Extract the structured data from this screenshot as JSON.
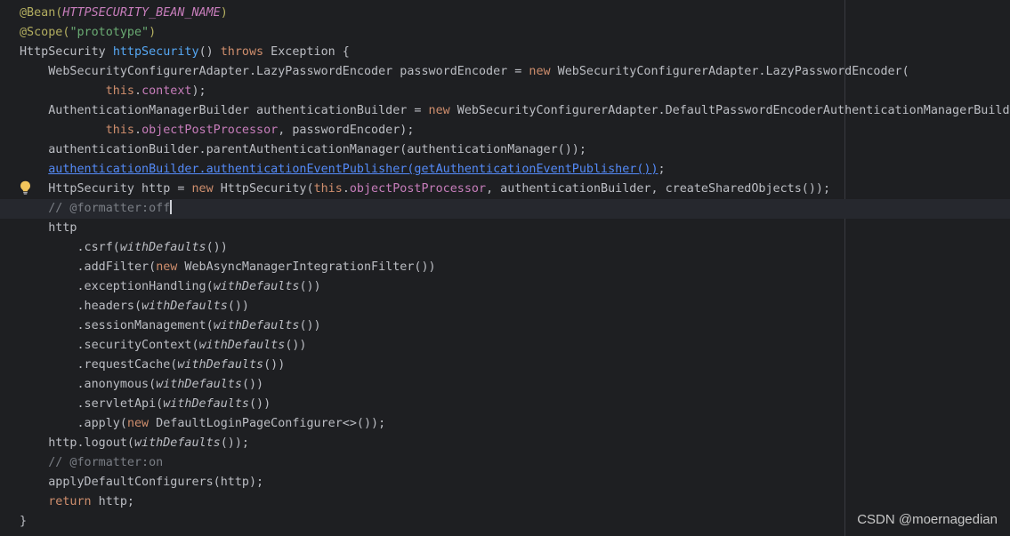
{
  "editor": {
    "caret_line": 10,
    "bulb_line": 9,
    "lines": [
      {
        "indent": "",
        "tokens": [
          {
            "c": "ann",
            "t": "@Bean("
          },
          {
            "c": "annarg",
            "t": "HTTPSECURITY_BEAN_NAME"
          },
          {
            "c": "ann",
            "t": ")"
          }
        ]
      },
      {
        "indent": "",
        "tokens": [
          {
            "c": "ann",
            "t": "@Scope("
          },
          {
            "c": "str",
            "t": "\"prototype\""
          },
          {
            "c": "ann",
            "t": ")"
          }
        ]
      },
      {
        "indent": "",
        "tokens": [
          {
            "c": "plain",
            "t": "HttpSecurity "
          },
          {
            "c": "method",
            "t": "httpSecurity"
          },
          {
            "c": "plain",
            "t": "() "
          },
          {
            "c": "kw",
            "t": "throws"
          },
          {
            "c": "plain",
            "t": " Exception {"
          }
        ]
      },
      {
        "indent": "    ",
        "tokens": [
          {
            "c": "plain",
            "t": "WebSecurityConfigurerAdapter.LazyPasswordEncoder passwordEncoder = "
          },
          {
            "c": "kw",
            "t": "new"
          },
          {
            "c": "plain",
            "t": " WebSecurityConfigurerAdapter.LazyPasswordEncoder("
          }
        ]
      },
      {
        "indent": "            ",
        "tokens": [
          {
            "c": "kw",
            "t": "this"
          },
          {
            "c": "plain",
            "t": "."
          },
          {
            "c": "field",
            "t": "context"
          },
          {
            "c": "plain",
            "t": ");"
          }
        ]
      },
      {
        "indent": "    ",
        "tokens": [
          {
            "c": "plain",
            "t": "AuthenticationManagerBuilder authenticationBuilder = "
          },
          {
            "c": "kw",
            "t": "new"
          },
          {
            "c": "plain",
            "t": " WebSecurityConfigurerAdapter.DefaultPasswordEncoderAuthenticationManagerBuilde"
          }
        ]
      },
      {
        "indent": "            ",
        "tokens": [
          {
            "c": "kw",
            "t": "this"
          },
          {
            "c": "plain",
            "t": "."
          },
          {
            "c": "field",
            "t": "objectPostProcessor"
          },
          {
            "c": "plain",
            "t": ", passwordEncoder);"
          }
        ]
      },
      {
        "indent": "    ",
        "tokens": [
          {
            "c": "plain",
            "t": "authenticationBuilder.parentAuthenticationManager(authenticationManager());"
          }
        ]
      },
      {
        "indent": "    ",
        "tokens": [
          {
            "c": "link",
            "t": "authenticationBuilder.authenticationEventPublisher(getAuthenticationEventPublisher())"
          },
          {
            "c": "plain",
            "t": ";"
          }
        ]
      },
      {
        "indent": "    ",
        "tokens": [
          {
            "c": "plain",
            "t": "HttpSecurity http = "
          },
          {
            "c": "kw",
            "t": "new"
          },
          {
            "c": "plain",
            "t": " HttpSecurity("
          },
          {
            "c": "kw",
            "t": "this"
          },
          {
            "c": "plain",
            "t": "."
          },
          {
            "c": "field",
            "t": "objectPostProcessor"
          },
          {
            "c": "plain",
            "t": ", authenticationBuilder, createSharedObjects());"
          }
        ]
      },
      {
        "indent": "    ",
        "tokens": [
          {
            "c": "comment",
            "t": "// @formatter:off"
          }
        ]
      },
      {
        "indent": "    ",
        "tokens": [
          {
            "c": "plain",
            "t": "http"
          }
        ]
      },
      {
        "indent": "        ",
        "tokens": [
          {
            "c": "plain",
            "t": ".csrf("
          },
          {
            "c": "italic",
            "t": "withDefaults"
          },
          {
            "c": "plain",
            "t": "())"
          }
        ]
      },
      {
        "indent": "        ",
        "tokens": [
          {
            "c": "plain",
            "t": ".addFilter("
          },
          {
            "c": "kw",
            "t": "new"
          },
          {
            "c": "plain",
            "t": " WebAsyncManagerIntegrationFilter())"
          }
        ]
      },
      {
        "indent": "        ",
        "tokens": [
          {
            "c": "plain",
            "t": ".exceptionHandling("
          },
          {
            "c": "italic",
            "t": "withDefaults"
          },
          {
            "c": "plain",
            "t": "())"
          }
        ]
      },
      {
        "indent": "        ",
        "tokens": [
          {
            "c": "plain",
            "t": ".headers("
          },
          {
            "c": "italic",
            "t": "withDefaults"
          },
          {
            "c": "plain",
            "t": "())"
          }
        ]
      },
      {
        "indent": "        ",
        "tokens": [
          {
            "c": "plain",
            "t": ".sessionManagement("
          },
          {
            "c": "italic",
            "t": "withDefaults"
          },
          {
            "c": "plain",
            "t": "())"
          }
        ]
      },
      {
        "indent": "        ",
        "tokens": [
          {
            "c": "plain",
            "t": ".securityContext("
          },
          {
            "c": "italic",
            "t": "withDefaults"
          },
          {
            "c": "plain",
            "t": "())"
          }
        ]
      },
      {
        "indent": "        ",
        "tokens": [
          {
            "c": "plain",
            "t": ".requestCache("
          },
          {
            "c": "italic",
            "t": "withDefaults"
          },
          {
            "c": "plain",
            "t": "())"
          }
        ]
      },
      {
        "indent": "        ",
        "tokens": [
          {
            "c": "plain",
            "t": ".anonymous("
          },
          {
            "c": "italic",
            "t": "withDefaults"
          },
          {
            "c": "plain",
            "t": "())"
          }
        ]
      },
      {
        "indent": "        ",
        "tokens": [
          {
            "c": "plain",
            "t": ".servletApi("
          },
          {
            "c": "italic",
            "t": "withDefaults"
          },
          {
            "c": "plain",
            "t": "())"
          }
        ]
      },
      {
        "indent": "        ",
        "tokens": [
          {
            "c": "plain",
            "t": ".apply("
          },
          {
            "c": "kw",
            "t": "new"
          },
          {
            "c": "plain",
            "t": " DefaultLoginPageConfigurer<>());"
          }
        ]
      },
      {
        "indent": "    ",
        "tokens": [
          {
            "c": "plain",
            "t": "http.logout("
          },
          {
            "c": "italic",
            "t": "withDefaults"
          },
          {
            "c": "plain",
            "t": "());"
          }
        ]
      },
      {
        "indent": "    ",
        "tokens": [
          {
            "c": "comment",
            "t": "// @formatter:on"
          }
        ]
      },
      {
        "indent": "    ",
        "tokens": [
          {
            "c": "plain",
            "t": "applyDefaultConfigurers(http);"
          }
        ]
      },
      {
        "indent": "    ",
        "tokens": [
          {
            "c": "kw",
            "t": "return"
          },
          {
            "c": "plain",
            "t": " http;"
          }
        ]
      },
      {
        "indent": "",
        "tokens": [
          {
            "c": "plain",
            "t": "}"
          }
        ]
      }
    ]
  },
  "watermark": {
    "text": "CSDN @moernagedian"
  },
  "icons": {
    "bulb": "lightbulb-icon"
  },
  "colors": {
    "background": "#1e1f22",
    "keyword": "#cf8e6d",
    "method": "#56a8f5",
    "string": "#6aab73",
    "field": "#c77dbb",
    "annotation": "#b3ae60",
    "comment": "#7a7e85",
    "link": "#548af7",
    "bulb": "#f2c55c"
  }
}
